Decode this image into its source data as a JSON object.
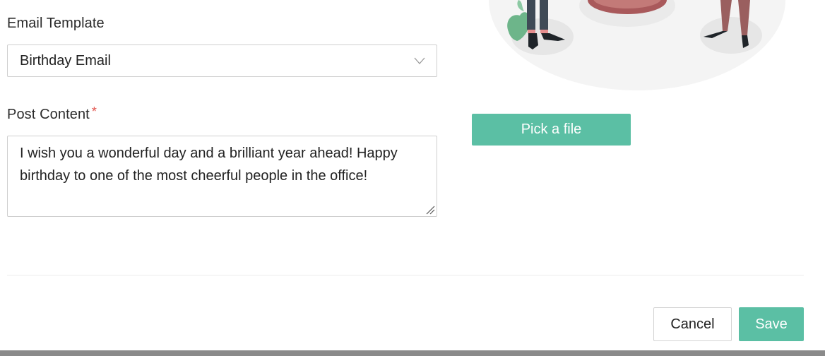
{
  "form": {
    "email_template_label": "Email Template",
    "email_template_value": "Birthday Email",
    "post_content_label": "Post Content",
    "required_mark": "*",
    "post_content_value": "I wish you a wonderful day and a brilliant year ahead! Happy birthday to one of the most cheerful people in the office!"
  },
  "media": {
    "pick_file_label": "Pick a file"
  },
  "footer": {
    "cancel_label": "Cancel",
    "save_label": "Save"
  },
  "colors": {
    "accent": "#5bbfa4",
    "required": "#e2554f"
  },
  "icons": {
    "select_chevron": "chevron-down-icon",
    "textarea_resize": "resize-grip-icon"
  }
}
